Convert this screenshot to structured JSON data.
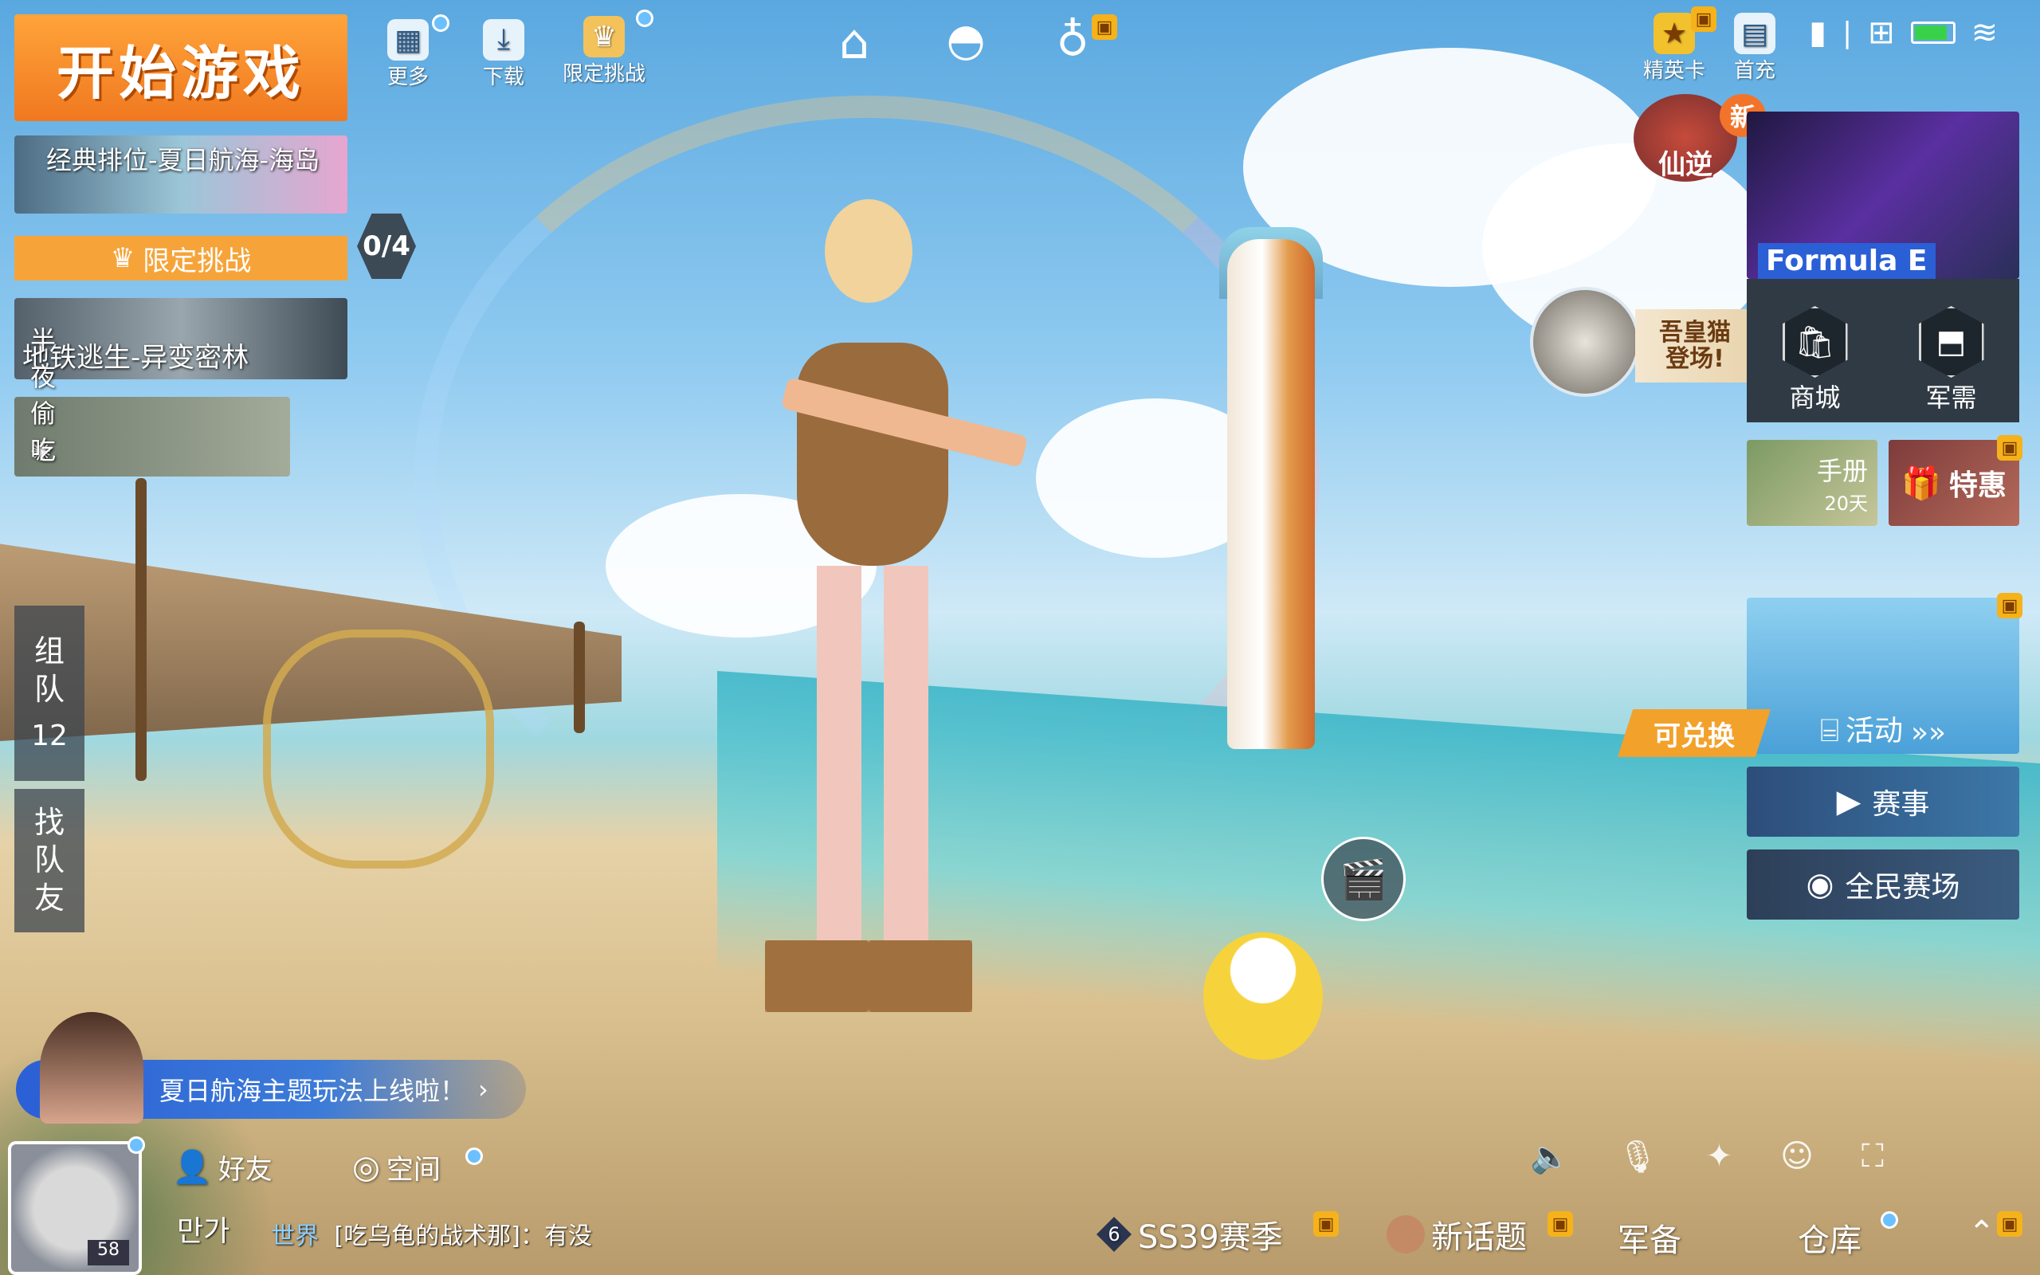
{
  "top_left": {
    "start_label": "开始游戏",
    "more_label": "更多",
    "download_label": "下载",
    "limited_label": "限定挑战"
  },
  "top_center": {
    "home_icon": "home-icon",
    "helmet_icon": "helmet-icon",
    "planet_icon": "planet-icon"
  },
  "top_right": {
    "elite_label": "精英卡",
    "first_recharge_label": "首充",
    "battery_color": "#39d14a"
  },
  "modes": {
    "classic_label": "经典排位-夏日航海-海岛",
    "limited_btn_label": "限定挑战",
    "counter": "0/4",
    "metro_label": "地铁逃生-异变密林",
    "midnight_label": "半夜偷吃"
  },
  "sidebar": {
    "team_label": "组\n队",
    "team_count": "12",
    "find_label": "找\n队\n友"
  },
  "right_panel": {
    "new_badge": "新",
    "xianni_label": "仙逆",
    "formula_label": "Formula E",
    "cat_promo": "吾皇猫\n登场!",
    "shop_label": "商城",
    "supply_label": "军需",
    "manual_label": "手册",
    "manual_days": "20天",
    "special_label": "特惠",
    "exchange_label": "可兑换",
    "activity_label": "活动",
    "match_label": "赛事",
    "arena_label": "全民赛场"
  },
  "bottom": {
    "news_text": "夏日航海主题玩法上线啦！",
    "friends_label": "好友",
    "space_label": "空间",
    "username": "만가",
    "level": "58",
    "chat_channel": "世界",
    "chat_text": "[吃乌龟的战术那]：有没",
    "season_rank": "6",
    "season_label": "SS39赛季",
    "topic_label": "新话题",
    "equip_label": "军备",
    "warehouse_label": "仓库"
  },
  "colors": {
    "accent_orange": "#f07820",
    "blue_badge": "#6cc0ff",
    "gift_gold": "#f5b21a"
  }
}
